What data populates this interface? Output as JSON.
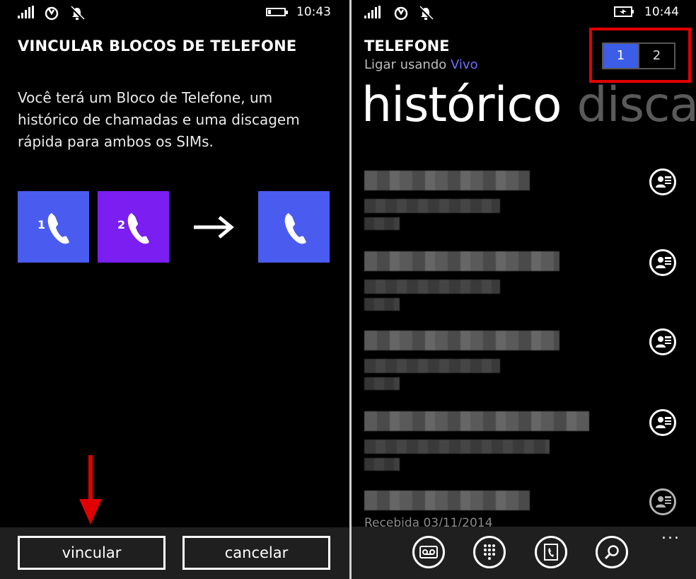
{
  "left": {
    "status": {
      "time": "10:43"
    },
    "title": "VINCULAR BLOCOS DE TELEFONE",
    "description": "Você terá um Bloco de Telefone, um histórico de chamadas e uma discagem rápida para ambos os SIMs.",
    "tiles": [
      {
        "sim": "1",
        "color": "#4a5cf0"
      },
      {
        "sim": "2",
        "color": "#7a1ef2"
      },
      {
        "sim": "",
        "color": "#4a5cf0"
      }
    ],
    "buttons": {
      "link": "vincular",
      "cancel": "cancelar"
    }
  },
  "right": {
    "status": {
      "time": "10:44"
    },
    "app_title": "TELEFONE",
    "subtitle_prefix": "Ligar usando",
    "carrier": "Vivo",
    "pivot": {
      "active": "histórico",
      "next": "discag"
    },
    "sim_switch": {
      "sim1": "1",
      "sim2": "2",
      "selected": "1"
    },
    "calls": [
      {
        "caption": ""
      },
      {
        "caption": ""
      },
      {
        "caption": ""
      },
      {
        "caption": ""
      },
      {
        "caption": "Recebida  03/11/2014"
      }
    ],
    "appbar": {
      "icons": [
        "voicemail-icon",
        "keypad-icon",
        "contacts-icon",
        "search-icon"
      ],
      "more": "..."
    }
  },
  "colors": {
    "accent": "#3b5de8",
    "highlight": "#e30000",
    "appbar": "#1f1f1f"
  }
}
